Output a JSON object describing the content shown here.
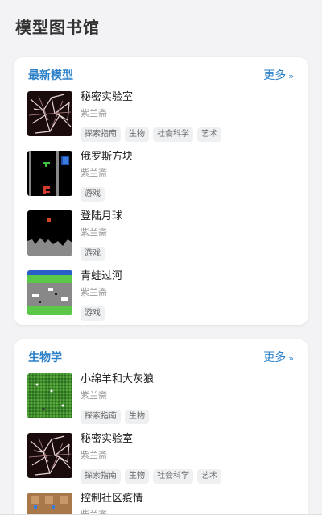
{
  "page": {
    "title": "模型图书馆"
  },
  "sections": [
    {
      "title": "最新模型",
      "more": "更多",
      "items": [
        {
          "name": "秘密实验室",
          "author": "紫兰斋",
          "tags": [
            "探索指南",
            "生物",
            "社会科学",
            "艺术"
          ],
          "thumb": "web-network-icon"
        },
        {
          "name": "俄罗斯方块",
          "author": "紫兰斋",
          "tags": [
            "游戏"
          ],
          "thumb": "tetris-icon"
        },
        {
          "name": "登陆月球",
          "author": "紫兰斋",
          "tags": [
            "游戏"
          ],
          "thumb": "moon-landing-icon"
        },
        {
          "name": "青蛙过河",
          "author": "紫兰斋",
          "tags": [
            "游戏"
          ],
          "thumb": "frogger-icon"
        }
      ]
    },
    {
      "title": "生物学",
      "more": "更多",
      "items": [
        {
          "name": "小绵羊和大灰狼",
          "author": "紫兰斋",
          "tags": [
            "探索指南",
            "生物"
          ],
          "thumb": "grass-field-icon"
        },
        {
          "name": "秘密实验室",
          "author": "紫兰斋",
          "tags": [
            "探索指南",
            "生物",
            "社会科学",
            "艺术"
          ],
          "thumb": "web-network-icon"
        },
        {
          "name": "控制社区疫情",
          "author": "紫兰斋",
          "tags": [],
          "thumb": "town-grid-icon"
        }
      ]
    }
  ],
  "colors": {
    "accent": "#2a7fc8",
    "background": "#f3f3f5",
    "card": "#ffffff"
  }
}
